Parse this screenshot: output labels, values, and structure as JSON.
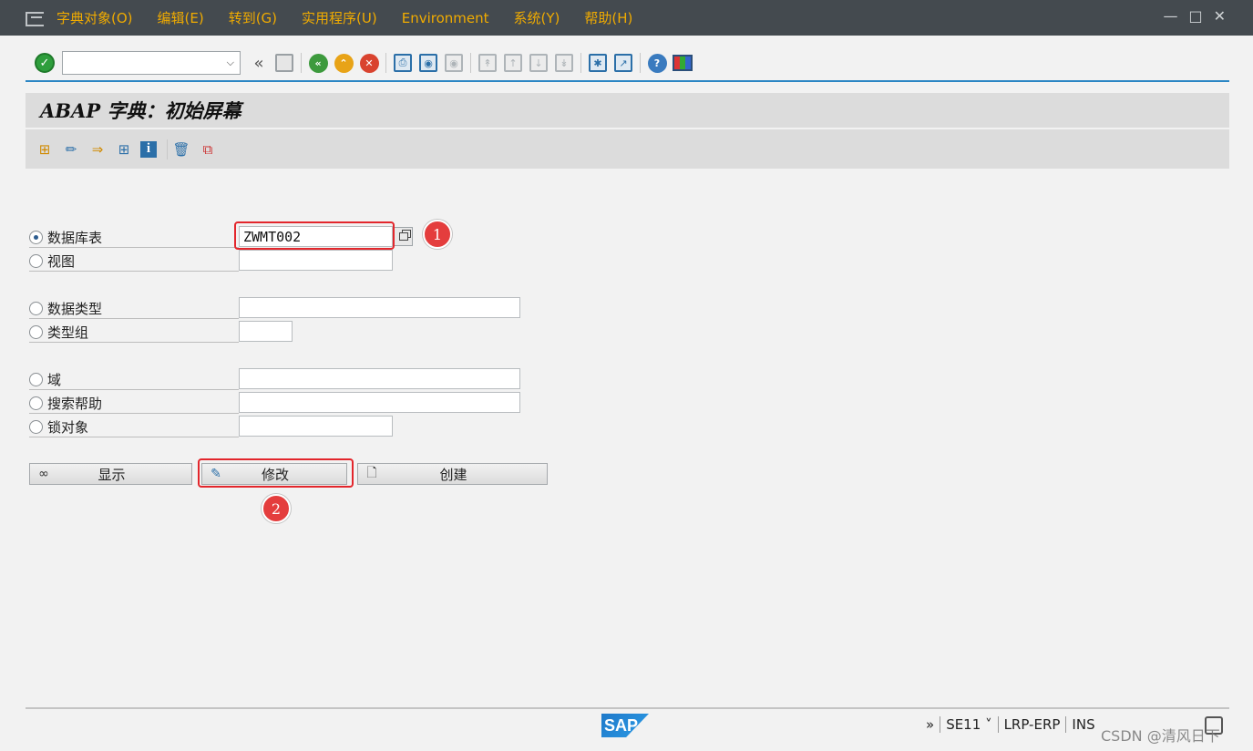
{
  "menu": {
    "items": [
      "字典对象(O)",
      "编辑(E)",
      "转到(G)",
      "实用程序(U)",
      "Environment",
      "系统(Y)",
      "帮助(H)"
    ],
    "window_controls": [
      "minimize-icon",
      "maximize-icon",
      "close-icon"
    ]
  },
  "toolbar": {
    "command_field_value": "",
    "icons": [
      "enter-icon",
      "command-dropdown-icon",
      "collapse-icon",
      "save-icon",
      "back-icon",
      "exit-icon",
      "cancel-icon",
      "print-icon",
      "find-icon",
      "find-next-icon",
      "first-page-icon",
      "previous-page-icon",
      "next-page-icon",
      "last-page-icon",
      "new-session-icon",
      "create-shortcut-icon",
      "help-icon",
      "customize-layout-icon"
    ]
  },
  "title": "ABAP 字典：初始屏幕",
  "app_toolbar": {
    "icons": [
      "other-object-icon",
      "check-icon",
      "activate-icon",
      "where-used-icon",
      "info-icon",
      "delete-icon",
      "copy-icon"
    ]
  },
  "form": {
    "rows": [
      {
        "label": "数据库表",
        "value": "ZWMT002",
        "selected": true
      },
      {
        "label": "视图",
        "value": "",
        "selected": false
      },
      {
        "label": "数据类型",
        "value": "",
        "selected": false
      },
      {
        "label": "类型组",
        "value": "",
        "selected": false
      },
      {
        "label": "域",
        "value": "",
        "selected": false
      },
      {
        "label": "搜索帮助",
        "value": "",
        "selected": false
      },
      {
        "label": "锁对象",
        "value": "",
        "selected": false
      }
    ]
  },
  "buttons": {
    "display": "显示",
    "change": "修改",
    "create": "创建"
  },
  "annotations": {
    "marker1": "1",
    "marker2": "2"
  },
  "status": {
    "expand": "»",
    "transaction": "SE11",
    "system": "LRP-ERP",
    "mode": "INS",
    "logo": "SAP"
  },
  "watermark": "CSDN @清风日下",
  "colors": {
    "menu_bg": "#444a4f",
    "menu_text": "#f0ab00",
    "highlight": "#e3262c",
    "accent_line": "#2b86c4"
  }
}
